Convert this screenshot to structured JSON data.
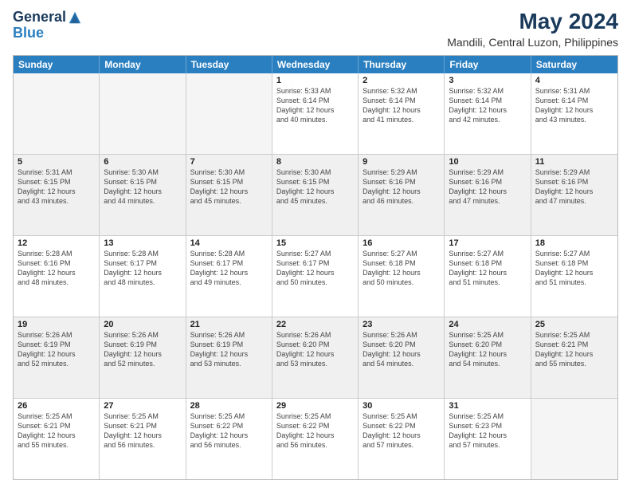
{
  "logo": {
    "line1": "General",
    "line2": "Blue"
  },
  "title": "May 2024",
  "subtitle": "Mandili, Central Luzon, Philippines",
  "days": [
    "Sunday",
    "Monday",
    "Tuesday",
    "Wednesday",
    "Thursday",
    "Friday",
    "Saturday"
  ],
  "weeks": [
    [
      {
        "day": "",
        "info": ""
      },
      {
        "day": "",
        "info": ""
      },
      {
        "day": "",
        "info": ""
      },
      {
        "day": "1",
        "info": "Sunrise: 5:33 AM\nSunset: 6:14 PM\nDaylight: 12 hours\nand 40 minutes."
      },
      {
        "day": "2",
        "info": "Sunrise: 5:32 AM\nSunset: 6:14 PM\nDaylight: 12 hours\nand 41 minutes."
      },
      {
        "day": "3",
        "info": "Sunrise: 5:32 AM\nSunset: 6:14 PM\nDaylight: 12 hours\nand 42 minutes."
      },
      {
        "day": "4",
        "info": "Sunrise: 5:31 AM\nSunset: 6:14 PM\nDaylight: 12 hours\nand 43 minutes."
      }
    ],
    [
      {
        "day": "5",
        "info": "Sunrise: 5:31 AM\nSunset: 6:15 PM\nDaylight: 12 hours\nand 43 minutes."
      },
      {
        "day": "6",
        "info": "Sunrise: 5:30 AM\nSunset: 6:15 PM\nDaylight: 12 hours\nand 44 minutes."
      },
      {
        "day": "7",
        "info": "Sunrise: 5:30 AM\nSunset: 6:15 PM\nDaylight: 12 hours\nand 45 minutes."
      },
      {
        "day": "8",
        "info": "Sunrise: 5:30 AM\nSunset: 6:15 PM\nDaylight: 12 hours\nand 45 minutes."
      },
      {
        "day": "9",
        "info": "Sunrise: 5:29 AM\nSunset: 6:16 PM\nDaylight: 12 hours\nand 46 minutes."
      },
      {
        "day": "10",
        "info": "Sunrise: 5:29 AM\nSunset: 6:16 PM\nDaylight: 12 hours\nand 47 minutes."
      },
      {
        "day": "11",
        "info": "Sunrise: 5:29 AM\nSunset: 6:16 PM\nDaylight: 12 hours\nand 47 minutes."
      }
    ],
    [
      {
        "day": "12",
        "info": "Sunrise: 5:28 AM\nSunset: 6:16 PM\nDaylight: 12 hours\nand 48 minutes."
      },
      {
        "day": "13",
        "info": "Sunrise: 5:28 AM\nSunset: 6:17 PM\nDaylight: 12 hours\nand 48 minutes."
      },
      {
        "day": "14",
        "info": "Sunrise: 5:28 AM\nSunset: 6:17 PM\nDaylight: 12 hours\nand 49 minutes."
      },
      {
        "day": "15",
        "info": "Sunrise: 5:27 AM\nSunset: 6:17 PM\nDaylight: 12 hours\nand 50 minutes."
      },
      {
        "day": "16",
        "info": "Sunrise: 5:27 AM\nSunset: 6:18 PM\nDaylight: 12 hours\nand 50 minutes."
      },
      {
        "day": "17",
        "info": "Sunrise: 5:27 AM\nSunset: 6:18 PM\nDaylight: 12 hours\nand 51 minutes."
      },
      {
        "day": "18",
        "info": "Sunrise: 5:27 AM\nSunset: 6:18 PM\nDaylight: 12 hours\nand 51 minutes."
      }
    ],
    [
      {
        "day": "19",
        "info": "Sunrise: 5:26 AM\nSunset: 6:19 PM\nDaylight: 12 hours\nand 52 minutes."
      },
      {
        "day": "20",
        "info": "Sunrise: 5:26 AM\nSunset: 6:19 PM\nDaylight: 12 hours\nand 52 minutes."
      },
      {
        "day": "21",
        "info": "Sunrise: 5:26 AM\nSunset: 6:19 PM\nDaylight: 12 hours\nand 53 minutes."
      },
      {
        "day": "22",
        "info": "Sunrise: 5:26 AM\nSunset: 6:20 PM\nDaylight: 12 hours\nand 53 minutes."
      },
      {
        "day": "23",
        "info": "Sunrise: 5:26 AM\nSunset: 6:20 PM\nDaylight: 12 hours\nand 54 minutes."
      },
      {
        "day": "24",
        "info": "Sunrise: 5:25 AM\nSunset: 6:20 PM\nDaylight: 12 hours\nand 54 minutes."
      },
      {
        "day": "25",
        "info": "Sunrise: 5:25 AM\nSunset: 6:21 PM\nDaylight: 12 hours\nand 55 minutes."
      }
    ],
    [
      {
        "day": "26",
        "info": "Sunrise: 5:25 AM\nSunset: 6:21 PM\nDaylight: 12 hours\nand 55 minutes."
      },
      {
        "day": "27",
        "info": "Sunrise: 5:25 AM\nSunset: 6:21 PM\nDaylight: 12 hours\nand 56 minutes."
      },
      {
        "day": "28",
        "info": "Sunrise: 5:25 AM\nSunset: 6:22 PM\nDaylight: 12 hours\nand 56 minutes."
      },
      {
        "day": "29",
        "info": "Sunrise: 5:25 AM\nSunset: 6:22 PM\nDaylight: 12 hours\nand 56 minutes."
      },
      {
        "day": "30",
        "info": "Sunrise: 5:25 AM\nSunset: 6:22 PM\nDaylight: 12 hours\nand 57 minutes."
      },
      {
        "day": "31",
        "info": "Sunrise: 5:25 AM\nSunset: 6:23 PM\nDaylight: 12 hours\nand 57 minutes."
      },
      {
        "day": "",
        "info": ""
      }
    ]
  ]
}
